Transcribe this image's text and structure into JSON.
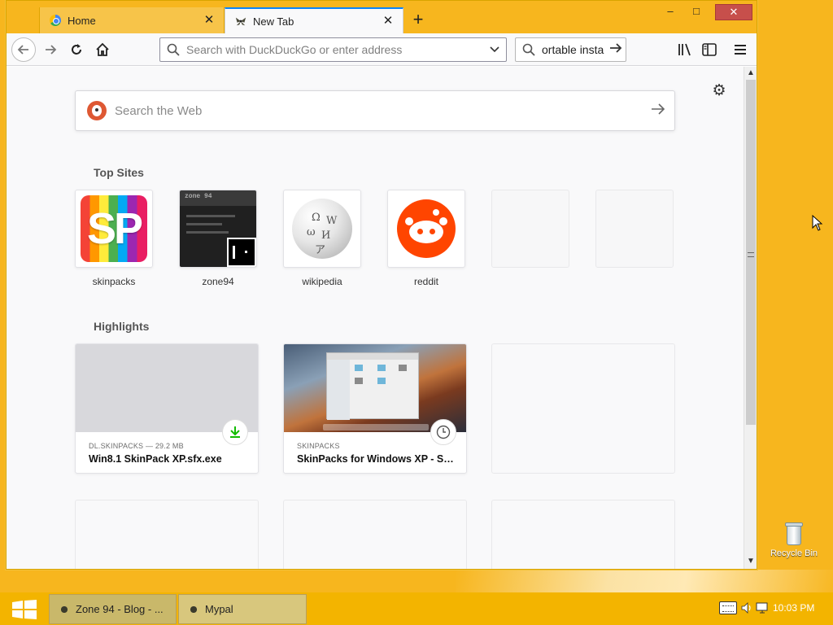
{
  "browser": {
    "tabs": [
      {
        "label": "Home",
        "active": false
      },
      {
        "label": "New Tab",
        "active": true
      }
    ],
    "window_controls": {
      "minimize": "–",
      "maximize": "□",
      "close": "✕"
    },
    "url_bar": {
      "value": "",
      "placeholder": "Search with DuckDuckGo or enter address"
    },
    "search_bar": {
      "value": "ortable insta"
    }
  },
  "newtab": {
    "web_search": {
      "placeholder": "Search the Web"
    },
    "top_sites_title": "Top Sites",
    "top_sites": [
      {
        "name": "skinpacks"
      },
      {
        "name": "zone94"
      },
      {
        "name": "wikipedia"
      },
      {
        "name": "reddit"
      },
      {
        "name": ""
      },
      {
        "name": ""
      }
    ],
    "highlights_title": "Highlights",
    "highlights": [
      {
        "meta": "DL.SKINPACKS — 29.2 MB",
        "title": "Win8.1 SkinPack XP.sfx.exe",
        "badge_icon": "download-icon"
      },
      {
        "meta": "SKINPACKS",
        "title": "SkinPacks for Windows XP - Ski...",
        "badge_icon": "clock-icon"
      }
    ],
    "tile_text": {
      "sp": "SP",
      "zone_header": "zone 94"
    }
  },
  "desktop": {
    "recycle_bin_label": "Recycle Bin"
  },
  "taskbar": {
    "items": [
      {
        "label": "Zone 94 - Blog - ..."
      },
      {
        "label": "Mypal"
      }
    ],
    "clock": "10:03 PM"
  },
  "colors": {
    "desktop": "#f7b61e",
    "accent": "#0a84ff",
    "close_button": "#c74f4b",
    "download_green": "#12bc00",
    "reddit": "#ff4500"
  }
}
